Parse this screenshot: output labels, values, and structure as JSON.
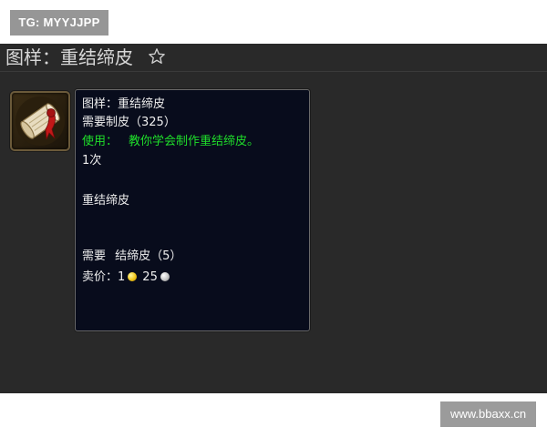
{
  "watermark": {
    "tg_text": "TG: MYYJJPP",
    "site_text": "www.bbaxx.cn"
  },
  "header": {
    "title": "图样：重结缔皮",
    "favorite_icon": "star-outline-icon"
  },
  "item": {
    "icon": "pattern-scroll-icon"
  },
  "tooltip": {
    "name": "图样：重结缔皮",
    "requirement": "需要制皮（325）",
    "use_prefix": "使用：",
    "use_text": "教你学会制作重结缔皮。",
    "charges": "1次",
    "produces": "重结缔皮",
    "reagents_label": "需要",
    "reagents": "结缔皮（5）",
    "sell_label": "卖价：",
    "price_gold": "1",
    "price_silver": "25"
  },
  "colors": {
    "panel_bg": "#292929",
    "tooltip_bg": "#080c1c",
    "use_text": "#1fdf2a",
    "gold_coin": "#f2c619",
    "silver_coin": "#c4c4c4"
  }
}
